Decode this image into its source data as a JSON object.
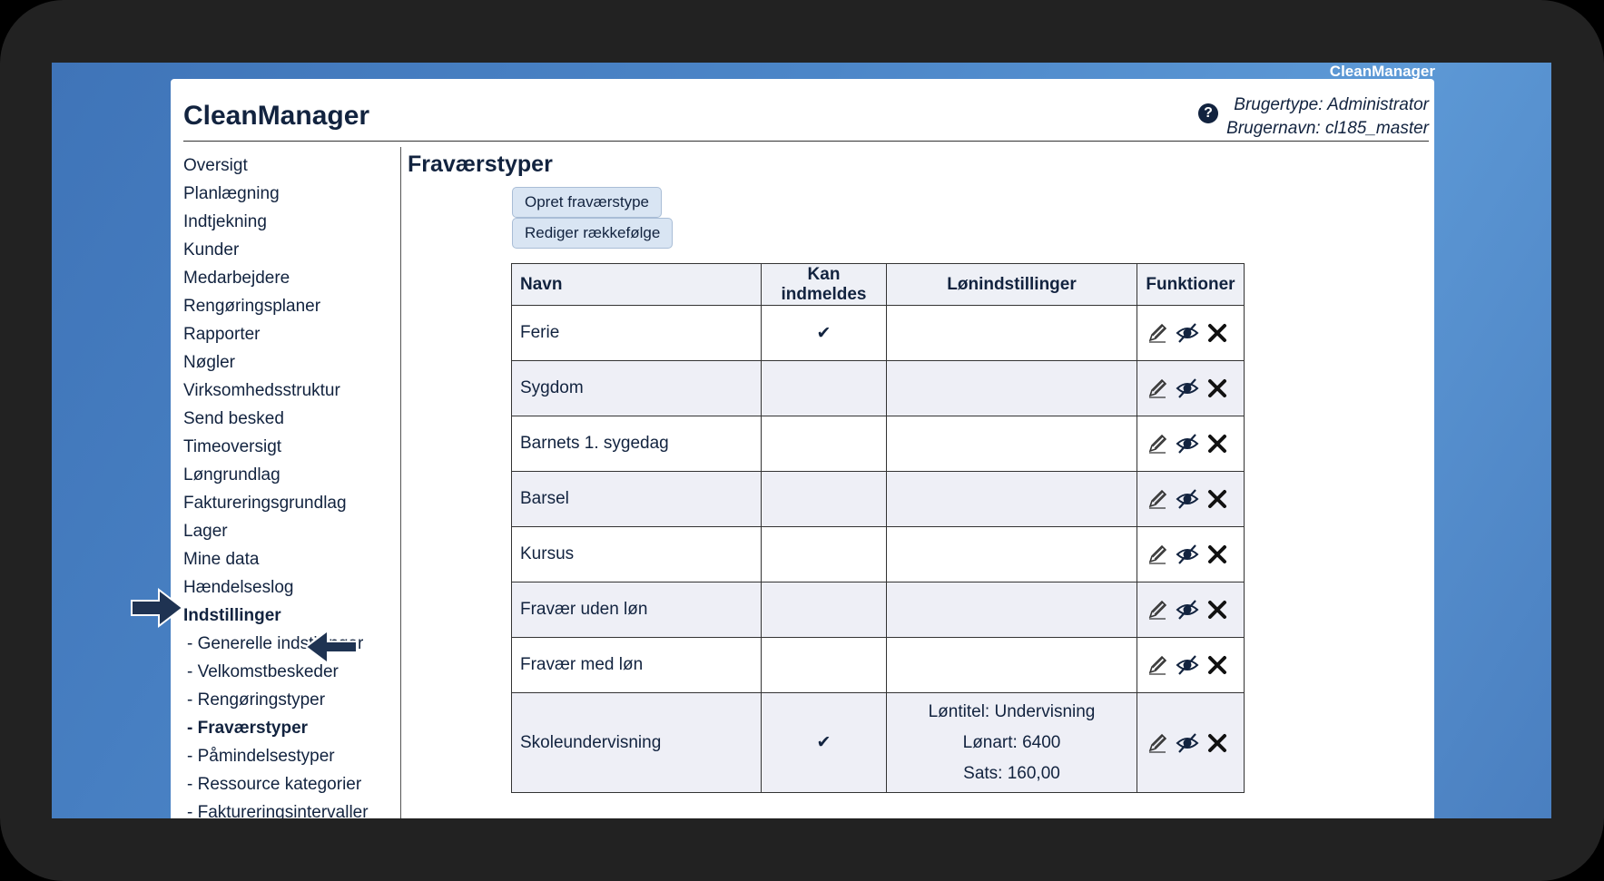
{
  "screen": {
    "brand": "CleanManager"
  },
  "header": {
    "title": "CleanManager",
    "user_type": "Brugertype: Administrator",
    "username": "Brugernavn: cl185_master",
    "help_glyph": "?"
  },
  "sidebar": {
    "items": [
      "Oversigt",
      "Planlægning",
      "Indtjekning",
      "Kunder",
      "Medarbejdere",
      "Rengøringsplaner",
      "Rapporter",
      "Nøgler",
      "Virksomhedsstruktur",
      "Send besked",
      "Timeoversigt",
      "Løngrundlag",
      "Faktureringsgrundlag",
      "Lager",
      "Mine data",
      "Hændelseslog"
    ],
    "active_item": "Indstillinger",
    "sub_items": [
      "- Generelle indstillinger",
      "- Velkomstbeskeder",
      "- Rengøringstyper",
      "- Fraværstyper",
      "- Påmindelsestyper",
      "- Ressource kategorier",
      "- Faktureringsintervaller"
    ],
    "active_sub_index": 3
  },
  "main": {
    "title": "Fraværstyper",
    "buttons": {
      "create": "Opret fraværstype",
      "reorder": "Rediger rækkefølge"
    },
    "table": {
      "headers": [
        "Navn",
        "Kan indmeldes",
        "Lønindstillinger",
        "Funktioner"
      ],
      "rows": [
        {
          "name": "Ferie",
          "reportable": "✔",
          "salary": []
        },
        {
          "name": "Sygdom",
          "reportable": "",
          "salary": []
        },
        {
          "name": "Barnets 1. sygedag",
          "reportable": "",
          "salary": []
        },
        {
          "name": "Barsel",
          "reportable": "",
          "salary": []
        },
        {
          "name": "Kursus",
          "reportable": "",
          "salary": []
        },
        {
          "name": "Fravær uden løn",
          "reportable": "",
          "salary": []
        },
        {
          "name": "Fravær med løn",
          "reportable": "",
          "salary": []
        },
        {
          "name": "Skoleundervisning",
          "reportable": "✔",
          "salary": [
            "Løntitel: Undervisning",
            "Lønart: 6400",
            "Sats: 160,00"
          ]
        }
      ],
      "function_icons": [
        "pencil-icon",
        "eye-slash-icon",
        "close-icon"
      ]
    }
  },
  "colors": {
    "navy": "#12233f",
    "button_bg": "#d9e5f3",
    "row_alt": "#eeeff6",
    "desktop_blue": "#4c86c8",
    "arrow": "#1f3352"
  }
}
